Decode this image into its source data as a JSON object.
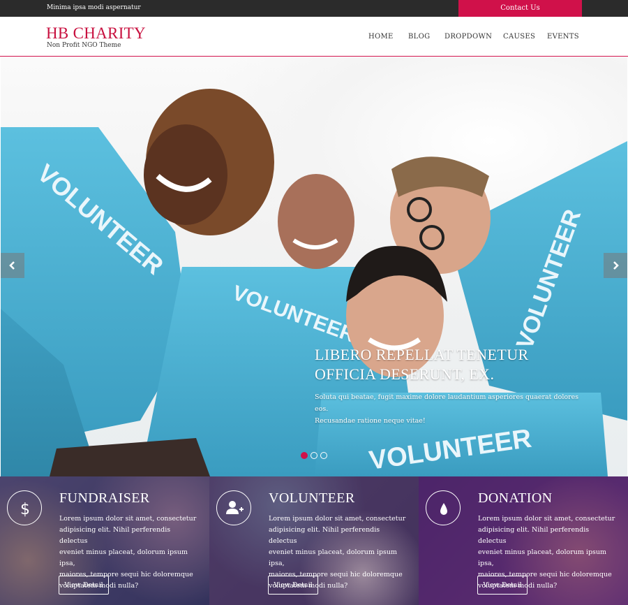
{
  "topbar": {
    "tagline": "Minima ipsa modi aspernatur",
    "contact_label": "Contact Us"
  },
  "header": {
    "brand_title": "HB CHARITY",
    "brand_subtitle": "Non Profit NGO Theme",
    "nav": [
      "HOME",
      "BLOG",
      "DROPDOWN",
      "CAUSES",
      "EVENTS"
    ]
  },
  "hero": {
    "shirt_text": "VOLUNTEER",
    "caption_title_line1": "LIBERO REPELLAT TENETUR",
    "caption_title_line2": "OFFICIA DESERUNT, EX.",
    "caption_text_line1": "Soluta qui beatae, fugit maxime dolore laudantium asperiores quaerat dolores eos.",
    "caption_text_line2": "Recusandae ratione neque vitae!",
    "slide_count": 3,
    "active_slide": 1
  },
  "panels": [
    {
      "title": "FUNDRAISER",
      "icon": "dollar-icon",
      "text_lines": [
        "Lorem ipsum dolor sit amet, consectetur",
        "adipisicing elit. Nihil perferendis delectus",
        "eveniet minus placeat, dolorum ipsum ipsa,",
        "maiores, tempore sequi hic doloremque",
        "voluptatem modi nulla?"
      ],
      "button": "View Detail",
      "tint": "#2a2c5e"
    },
    {
      "title": "VOLUNTEER",
      "icon": "add-user-icon",
      "text_lines": [
        "Lorem ipsum dolor sit amet, consectetur",
        "adipisicing elit. Nihil perferendis delectus",
        "eveniet minus placeat, dolorum ipsum ipsa,",
        "maiores, tempore sequi hic doloremque",
        "voluptatem modi nulla?"
      ],
      "button": "View Detail",
      "tint": "#4a2a5e"
    },
    {
      "title": "DONATION",
      "icon": "drop-icon",
      "text_lines": [
        "Lorem ipsum dolor sit amet, consectetur",
        "adipisicing elit. Nihil perferendis delectus",
        "eveniet minus placeat, dolorum ipsum ipsa,",
        "maiores, tempore sequi hic doloremque",
        "voluptatem modi nulla?"
      ],
      "button": "View Detail",
      "tint": "#5a2a6e"
    }
  ],
  "colors": {
    "accent": "#d0114a",
    "topbar": "#2b2b2b",
    "shirt": "#4fb3d3"
  }
}
